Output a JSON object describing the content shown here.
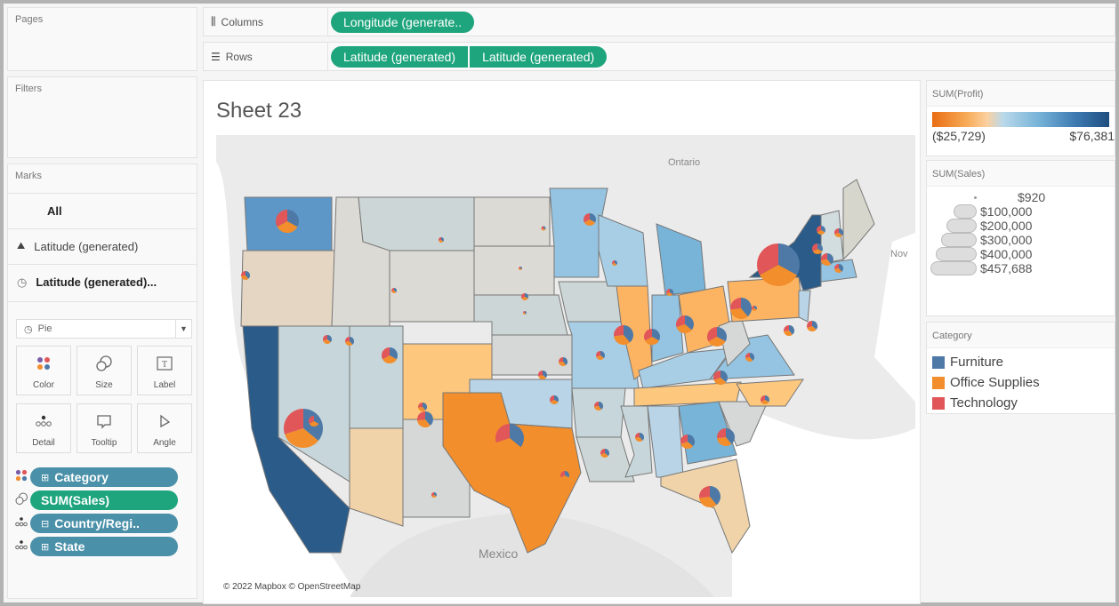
{
  "panels": {
    "pages": "Pages",
    "filters": "Filters",
    "marks": "Marks"
  },
  "shelves": {
    "columns": {
      "label": "Columns",
      "pills": [
        "Longitude (generate.."
      ]
    },
    "rows": {
      "label": "Rows",
      "pills": [
        "Latitude (generated)",
        "Latitude (generated)"
      ]
    }
  },
  "marks": {
    "layers": [
      {
        "label": "All",
        "icon": "none"
      },
      {
        "label": "Latitude (generated)",
        "icon": "map-icon"
      },
      {
        "label": "Latitude (generated)...",
        "icon": "pie-icon"
      }
    ],
    "mark_type": "Pie",
    "cards": [
      "Color",
      "Size",
      "Label",
      "Detail",
      "Tooltip",
      "Angle"
    ],
    "fields": [
      {
        "label": "Category",
        "encoding": "color",
        "type": "dimension",
        "prefix": "⊞"
      },
      {
        "label": "SUM(Sales)",
        "encoding": "size",
        "type": "measure",
        "prefix": ""
      },
      {
        "label": "Country/Regi..",
        "encoding": "detail",
        "type": "dimension",
        "prefix": "⊟"
      },
      {
        "label": "State",
        "encoding": "detail",
        "type": "dimension",
        "prefix": "⊞"
      }
    ]
  },
  "sheet": {
    "title": "Sheet 23",
    "map_labels": {
      "ontario": "Ontario",
      "mexico": "Mexico",
      "nova": "Nov"
    },
    "credit": "© 2022 Mapbox © OpenStreetMap"
  },
  "legends": {
    "profit": {
      "title": "SUM(Profit)",
      "min": "($25,729)",
      "max": "$76,381"
    },
    "sales": {
      "title": "SUM(Sales)",
      "items": [
        "$920",
        "$100,000",
        "$200,000",
        "$300,000",
        "$400,000",
        "$457,688"
      ]
    },
    "category": {
      "title": "Category",
      "items": [
        {
          "label": "Furniture",
          "color": "#4e79a7"
        },
        {
          "label": "Office Supplies",
          "color": "#f28e2b"
        },
        {
          "label": "Technology",
          "color": "#e15759"
        }
      ]
    }
  }
}
